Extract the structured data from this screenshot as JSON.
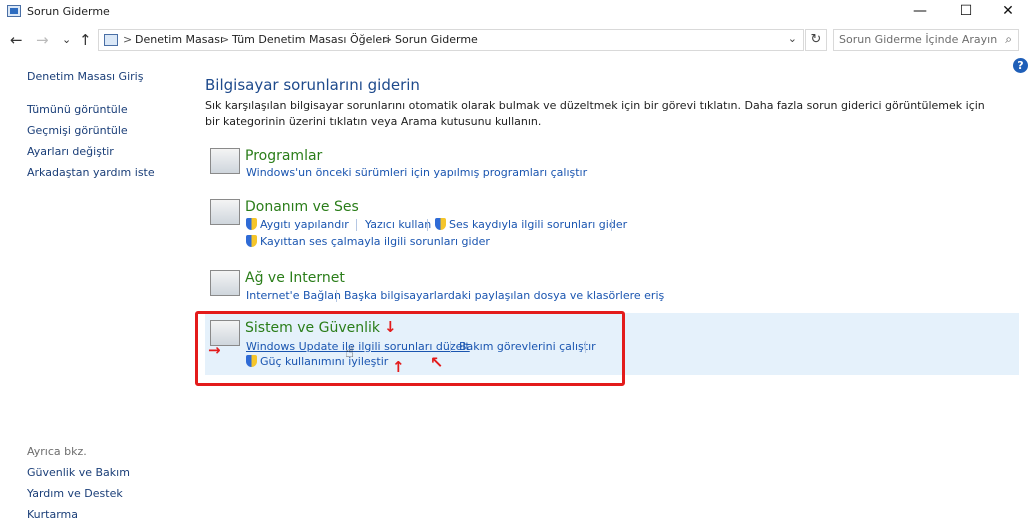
{
  "window": {
    "title": "Sorun Giderme",
    "minimize": "—",
    "maximize": "☐",
    "close": "✕"
  },
  "nav": {
    "back": "←",
    "forward": "→",
    "recent": "⌄",
    "up": "↑"
  },
  "address": {
    "crumbs": [
      "Denetim Masası",
      "Tüm Denetim Masası Öğeleri",
      "Sorun Giderme"
    ],
    "separator": ">",
    "dropdown": "⌄",
    "refresh": "↻"
  },
  "search": {
    "placeholder": "Sorun Giderme İçinde Arayın",
    "icon": "⌕"
  },
  "help": "?",
  "sidebar": {
    "home": "Denetim Masası Giriş",
    "items": [
      "Tümünü görüntüle",
      "Geçmişi görüntüle",
      "Ayarları değiştir",
      "Arkadaştan yardım iste"
    ],
    "see_also_title": "Ayrıca bkz.",
    "see_also": [
      "Güvenlik ve Bakım",
      "Yardım ve Destek",
      "Kurtarma"
    ]
  },
  "main": {
    "title": "Bilgisayar sorunlarını giderin",
    "description": "Sık karşılaşılan bilgisayar sorunlarını otomatik olarak bulmak ve düzeltmek için bir görevi tıklatın. Daha fazla sorun giderici görüntülemek için bir kategorinin üzerini tıklatın veya Arama kutusunu kullanın.",
    "categories": [
      {
        "title": "Programlar",
        "icon": "programs-icon",
        "links": [
          "Windows'un önceki sürümleri için yapılmış programları çalıştır"
        ]
      },
      {
        "title": "Donanım ve Ses",
        "icon": "hardware-sound-icon",
        "links": [
          "Aygıtı yapılandır",
          "Yazıcı kullan",
          "Ses kaydıyla ilgili sorunları gider",
          "Kayıttan ses çalmayla ilgili sorunları gider"
        ]
      },
      {
        "title": "Ağ ve Internet",
        "icon": "network-internet-icon",
        "links": [
          "Internet'e Bağlan",
          "Başka bilgisayarlardaki paylaşılan dosya ve klasörlere eriş"
        ]
      },
      {
        "title": "Sistem ve Güvenlik",
        "icon": "system-security-icon",
        "links": [
          "Windows Update ile ilgili sorunları düzelt",
          "Bakım görevlerini çalıştır",
          "Güç kullanımını iyileştir"
        ]
      }
    ]
  },
  "annotation": {
    "color": "#e31b1b",
    "arrows": [
      "→",
      "↓",
      "↑",
      "↖"
    ]
  },
  "colors": {
    "link": "#1a55b0",
    "category_title": "#2a7d19",
    "highlight": "#e5f1fb"
  }
}
